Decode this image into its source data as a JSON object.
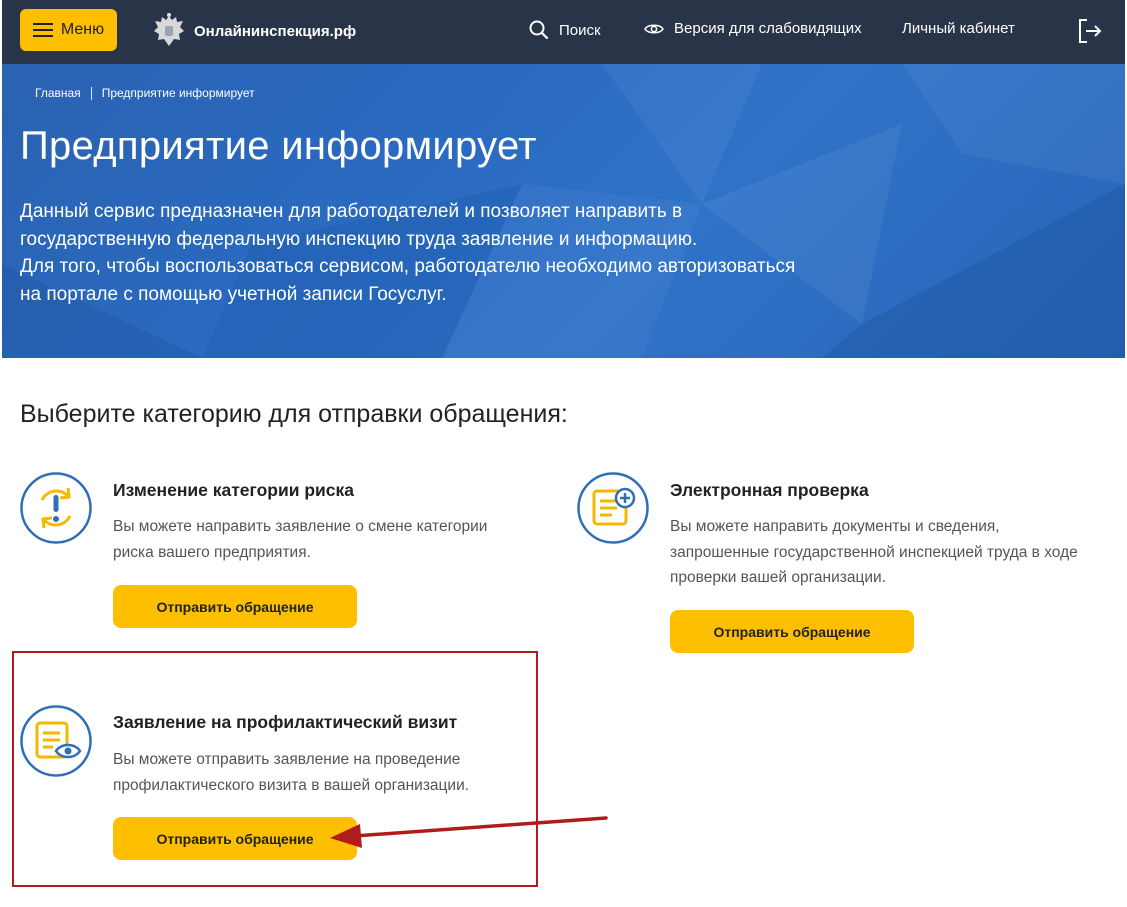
{
  "header": {
    "menu_label": "Меню",
    "logo_text": "Онлайнинспекция.рф",
    "search_label": "Поиск",
    "accessibility_label": "Версия для слабовидящих",
    "cabinet_label": "Личный кабинет"
  },
  "breadcrumb": {
    "home": "Главная",
    "current": "Предприятие информирует"
  },
  "hero": {
    "title": "Предприятие информирует",
    "desc_line1": "Данный сервис предназначен для работодателей и позволяет направить в",
    "desc_line2": "государственную федеральную инспекцию труда заявление и информацию.",
    "desc_line3": "Для того, чтобы воспользоваться сервисом, работодателю необходимо авторизоваться",
    "desc_line4": "на портале с помощью учетной записи Госуслуг."
  },
  "section": {
    "title": "Выберите категорию для отправки обращения:"
  },
  "cards": [
    {
      "title": "Изменение категории риска",
      "text_line1": "Вы можете направить заявление о смене категории",
      "text_line2": "риска вашего предприятия.",
      "button": "Отправить обращение",
      "icon": "risk-change-icon"
    },
    {
      "title": "Электронная проверка",
      "text_line1": "Вы можете направить документы и сведения,",
      "text_line2": "запрошенные государственной инспекцией труда в ходе",
      "text_line3": "проверки вашей организации.",
      "button": "Отправить обращение",
      "icon": "document-add-icon"
    },
    {
      "title": "Заявление на профилактический визит",
      "text_line1": "Вы можете отправить заявление на проведение",
      "text_line2": "профилактического визита в вашей организации.",
      "button": "Отправить обращение",
      "icon": "document-eye-icon"
    }
  ],
  "colors": {
    "header_bg": "#293449",
    "accent": "#fdbf00",
    "hero_bg": "#2a6ac0",
    "icon_blue": "#2f6fb6",
    "annotation_red": "#b01c1c"
  }
}
